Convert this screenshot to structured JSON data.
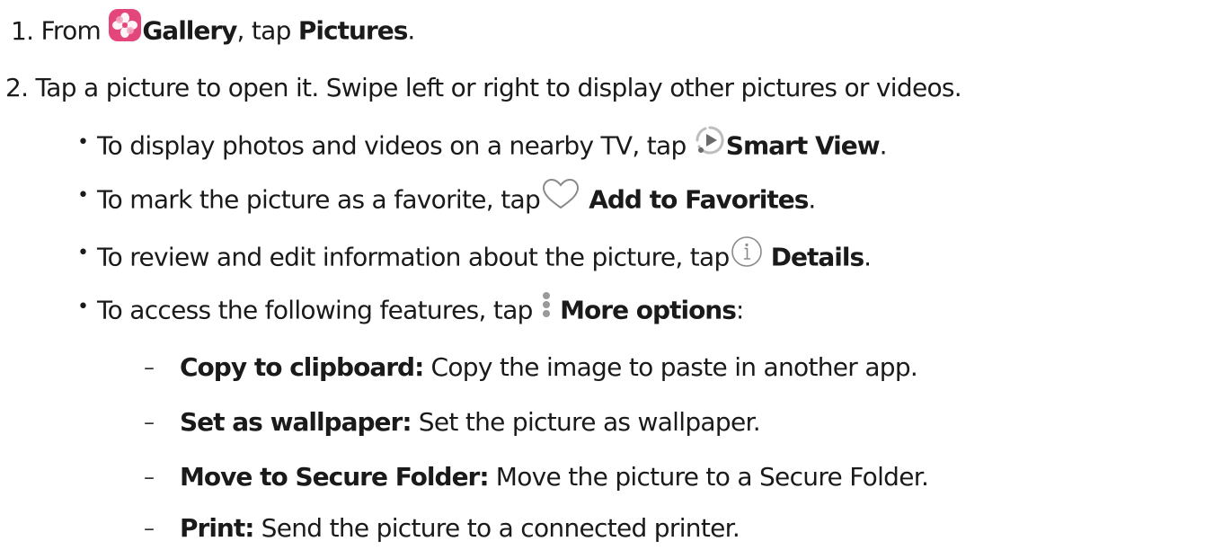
{
  "steps": [
    {
      "number": "1.",
      "pre": "From",
      "app_icon": "gallery-app-icon",
      "app": "Gallery",
      "mid": ", tap",
      "target": "Pictures",
      "end": "."
    },
    {
      "number": "2.",
      "text": "Tap a picture to open it. Swipe left or right to display other pictures or videos."
    }
  ],
  "bullets": [
    {
      "text": "To display photos and videos on a nearby TV, tap",
      "icon": "smart-view-icon",
      "label": "Smart View",
      "end": "."
    },
    {
      "text": "To mark the picture as a favorite, tap",
      "icon": "heart-icon",
      "label": "Add to Favorites",
      "end": "."
    },
    {
      "text": "To review and edit information about the picture, tap",
      "icon": "info-icon",
      "label": "Details",
      "end": "."
    },
    {
      "text": "To access the following features, tap",
      "icon": "more-options-icon",
      "label": "More options",
      "end": ":"
    }
  ],
  "subitems": [
    {
      "term": "Copy to clipboard",
      "sep": ":",
      "desc": "Copy the image to paste in another app."
    },
    {
      "term": "Set as wallpaper",
      "sep": ":",
      "desc": "Set the picture as wallpaper."
    },
    {
      "term": "Move to Secure Folder",
      "sep": ":",
      "desc": "Move the picture to a Secure Folder."
    },
    {
      "term": "Print",
      "sep": ":",
      "desc": "Send the picture to a connected printer."
    }
  ],
  "glyphs": {
    "bullet": "•",
    "dash": "–"
  },
  "colors": {
    "text": "#1a1a1a",
    "gallery_icon_bg": "#e2467a",
    "icon_stroke": "#bdbdbd",
    "icon_fill": "#6a6a6a"
  }
}
